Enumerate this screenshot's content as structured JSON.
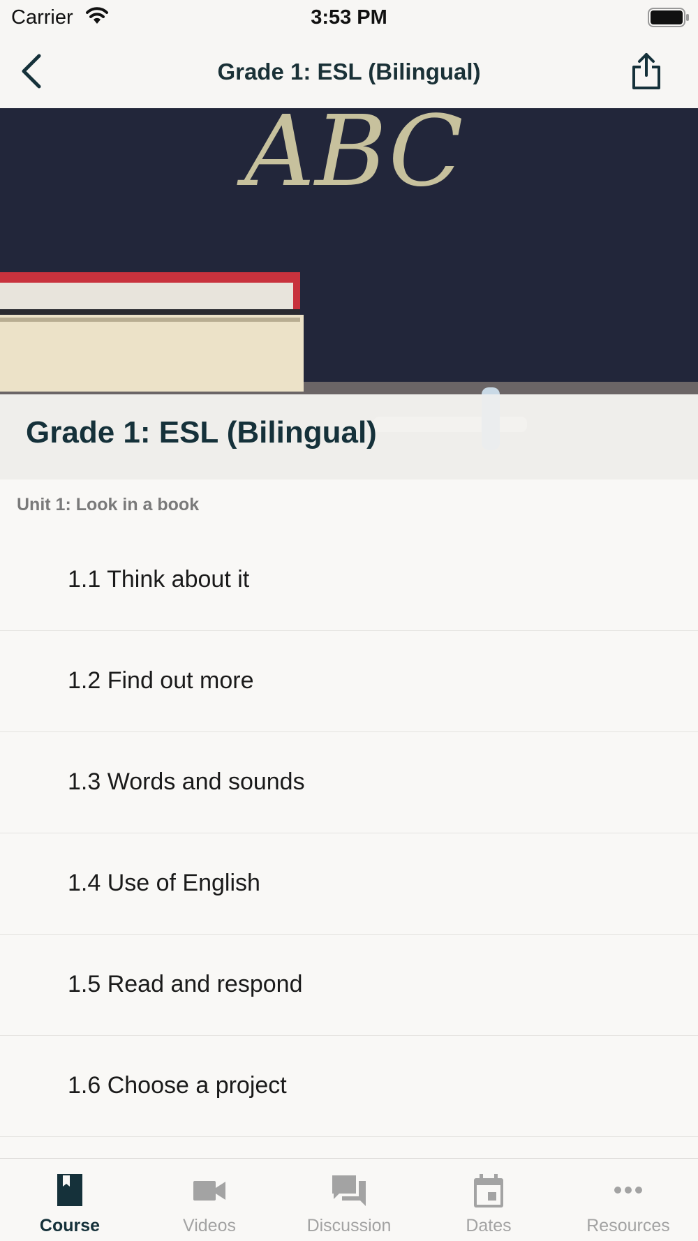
{
  "status_bar": {
    "carrier": "Carrier",
    "time": "3:53 PM"
  },
  "nav": {
    "title": "Grade 1: ESL (Bilingual)",
    "back_icon": "chevron-left-icon",
    "share_icon": "share-icon"
  },
  "hero": {
    "course_title": "Grade 1: ESL (Bilingual)",
    "chalk_text": "ABC"
  },
  "unit": {
    "title": "Unit 1: Look in a book"
  },
  "lessons": [
    {
      "label": "1.1 Think about it"
    },
    {
      "label": "1.2 Find out more"
    },
    {
      "label": "1.3 Words and sounds"
    },
    {
      "label": "1.4 Use of English"
    },
    {
      "label": "1.5 Read and respond"
    },
    {
      "label": "1.6 Choose a project"
    }
  ],
  "tabs": [
    {
      "label": "Course",
      "icon": "bookmark-icon",
      "active": true
    },
    {
      "label": "Videos",
      "icon": "video-camera-icon",
      "active": false
    },
    {
      "label": "Discussion",
      "icon": "chat-bubbles-icon",
      "active": false
    },
    {
      "label": "Dates",
      "icon": "calendar-icon",
      "active": false
    },
    {
      "label": "Resources",
      "icon": "more-dots-icon",
      "active": false
    }
  ],
  "colors": {
    "primary": "#15313a",
    "inactive": "#a3a3a3",
    "background": "#f9f8f6"
  }
}
